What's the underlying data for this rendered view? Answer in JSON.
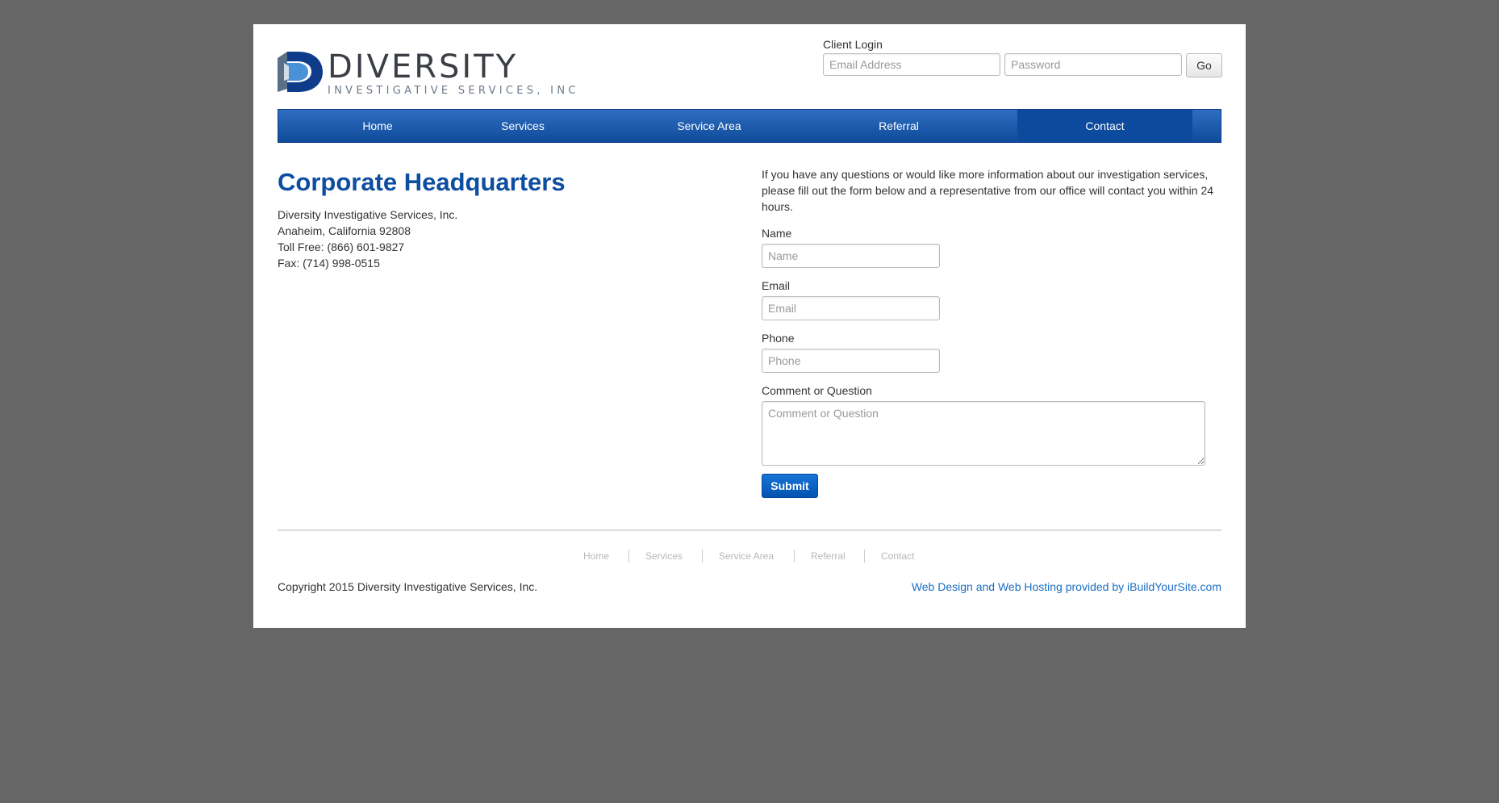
{
  "header": {
    "logo_word": "DIVERSITY",
    "logo_tagline": "INVESTIGATIVE SERVICES, INC.",
    "login": {
      "label": "Client Login",
      "email_placeholder": "Email Address",
      "password_placeholder": "Password",
      "go_label": "Go"
    }
  },
  "nav": {
    "items": [
      {
        "label": "Home"
      },
      {
        "label": "Services"
      },
      {
        "label": "Service Area"
      },
      {
        "label": "Referral"
      },
      {
        "label": "Contact"
      }
    ],
    "active": "Contact"
  },
  "headquarters": {
    "title": "Corporate Headquarters",
    "lines": [
      "Diversity Investigative Services, Inc.",
      "Anaheim, California 92808",
      "Toll Free: (866) 601-9827",
      "Fax: (714) 998-0515"
    ]
  },
  "contact_form": {
    "intro": "If you have any questions or would like more information about our investigation services, please fill out the form below and a representative from our office will contact you within 24 hours.",
    "name_label": "Name",
    "name_placeholder": "Name",
    "email_label": "Email",
    "email_placeholder": "Email",
    "phone_label": "Phone",
    "phone_placeholder": "Phone",
    "comment_label": "Comment or Question",
    "comment_placeholder": "Comment or Question",
    "submit_label": "Submit"
  },
  "footer": {
    "links": [
      {
        "label": "Home"
      },
      {
        "label": "Services"
      },
      {
        "label": "Service Area"
      },
      {
        "label": "Referral"
      },
      {
        "label": "Contact"
      }
    ],
    "copyright": "Copyright 2015 Diversity Investigative Services, Inc.",
    "credit": "Web Design and Web Hosting provided by iBuildYourSite.com"
  },
  "colors": {
    "page_bg": "#666666",
    "brand_blue": "#0d4ea0",
    "nav_blue": "#1a5cb0",
    "link_blue": "#1a6fc4"
  }
}
